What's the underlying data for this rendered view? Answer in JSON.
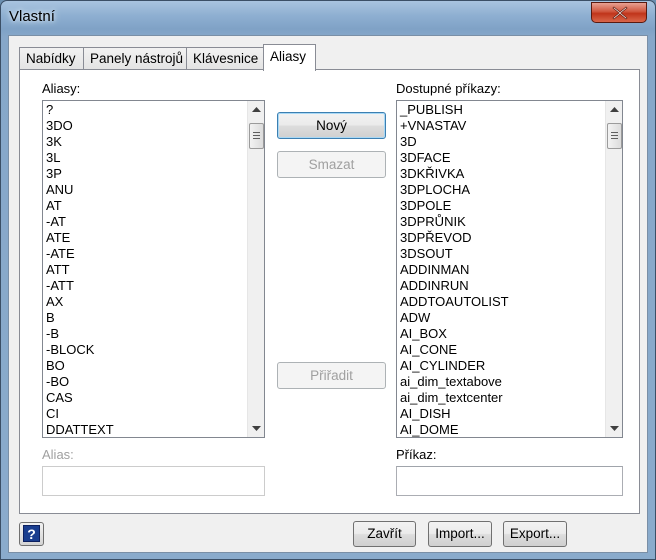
{
  "window": {
    "title": "Vlastní"
  },
  "tabs": [
    {
      "label": "Nabídky"
    },
    {
      "label": "Panely nástrojů"
    },
    {
      "label": "Klávesnice"
    },
    {
      "label": "Aliasy"
    }
  ],
  "aliases": {
    "label": "Aliasy:",
    "items": [
      "?",
      "3DO",
      "3K",
      "3L",
      "3P",
      "ANU",
      "AT",
      "-AT",
      "ATE",
      "-ATE",
      "ATT",
      "-ATT",
      "AX",
      "B",
      "-B",
      "-BLOCK",
      "BO",
      "-BO",
      "CAS",
      "CI",
      "DDATTEXT"
    ]
  },
  "commands": {
    "label": "Dostupné příkazy:",
    "items": [
      "_PUBLISH",
      "+VNASTAV",
      "3D",
      "3DFACE",
      "3DKŘIVKA",
      "3DPLOCHA",
      "3DPOLE",
      "3DPRŮNIK",
      "3DPŘEVOD",
      "3DSOUT",
      "ADDINMAN",
      "ADDINRUN",
      "ADDTOAUTOLIST",
      "ADW",
      "AI_BOX",
      "AI_CONE",
      "AI_CYLINDER",
      "ai_dim_textabove",
      "ai_dim_textcenter",
      "AI_DISH",
      "AI_DOME"
    ]
  },
  "buttons": {
    "new": "Nový",
    "delete": "Smazat",
    "assign": "Přiřadit",
    "close": "Zavřít",
    "import": "Import...",
    "export": "Export..."
  },
  "fields": {
    "alias_label": "Alias:",
    "alias_value": "",
    "command_label": "Příkaz:",
    "command_value": ""
  },
  "help": {
    "glyph": "?"
  },
  "icons": {
    "close": "close-icon",
    "help": "help-icon",
    "scroll_up": "scroll-up-arrow-icon",
    "scroll_down": "scroll-down-arrow-icon"
  }
}
